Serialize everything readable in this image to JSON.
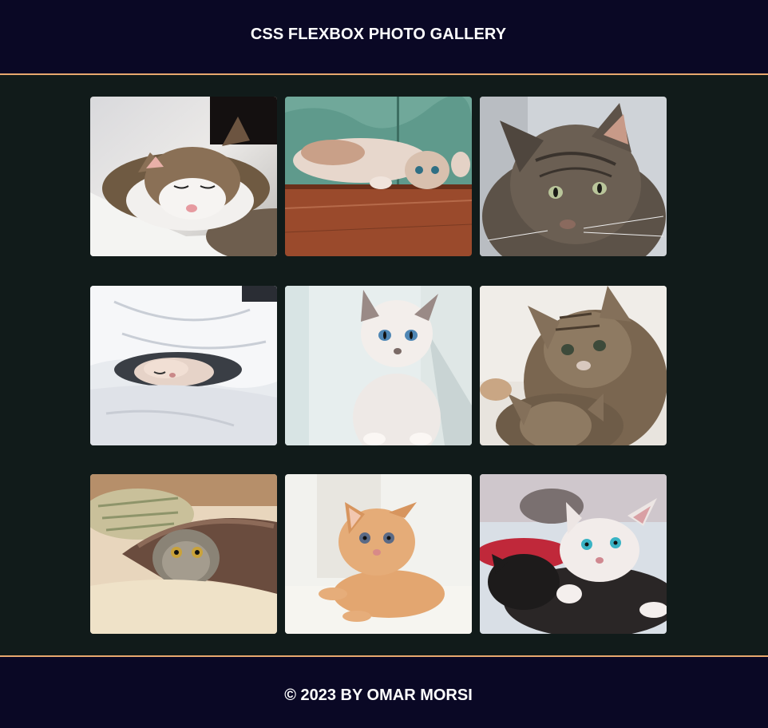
{
  "header": {
    "title": "CSS FLEXBOX PHOTO GALLERY"
  },
  "gallery": {
    "photos": [
      {
        "subject": "sleeping tabby-white cat on white blanket"
      },
      {
        "subject": "cat lying upside down on wooden floor"
      },
      {
        "subject": "long-haired tabby cat portrait"
      },
      {
        "subject": "cat sleeping under white duvet"
      },
      {
        "subject": "white kitten with blue eyes"
      },
      {
        "subject": "tabby kittens"
      },
      {
        "subject": "tabby kitten hiding under blanket"
      },
      {
        "subject": "ginger kitten lying down"
      },
      {
        "subject": "white and black kittens"
      }
    ]
  },
  "footer": {
    "text": "© 2023 BY OMAR MORSI"
  },
  "colors": {
    "header_bg": "#0a0825",
    "body_bg": "#111b1a",
    "accent_border": "#e8a86e",
    "text": "#ffffff"
  }
}
